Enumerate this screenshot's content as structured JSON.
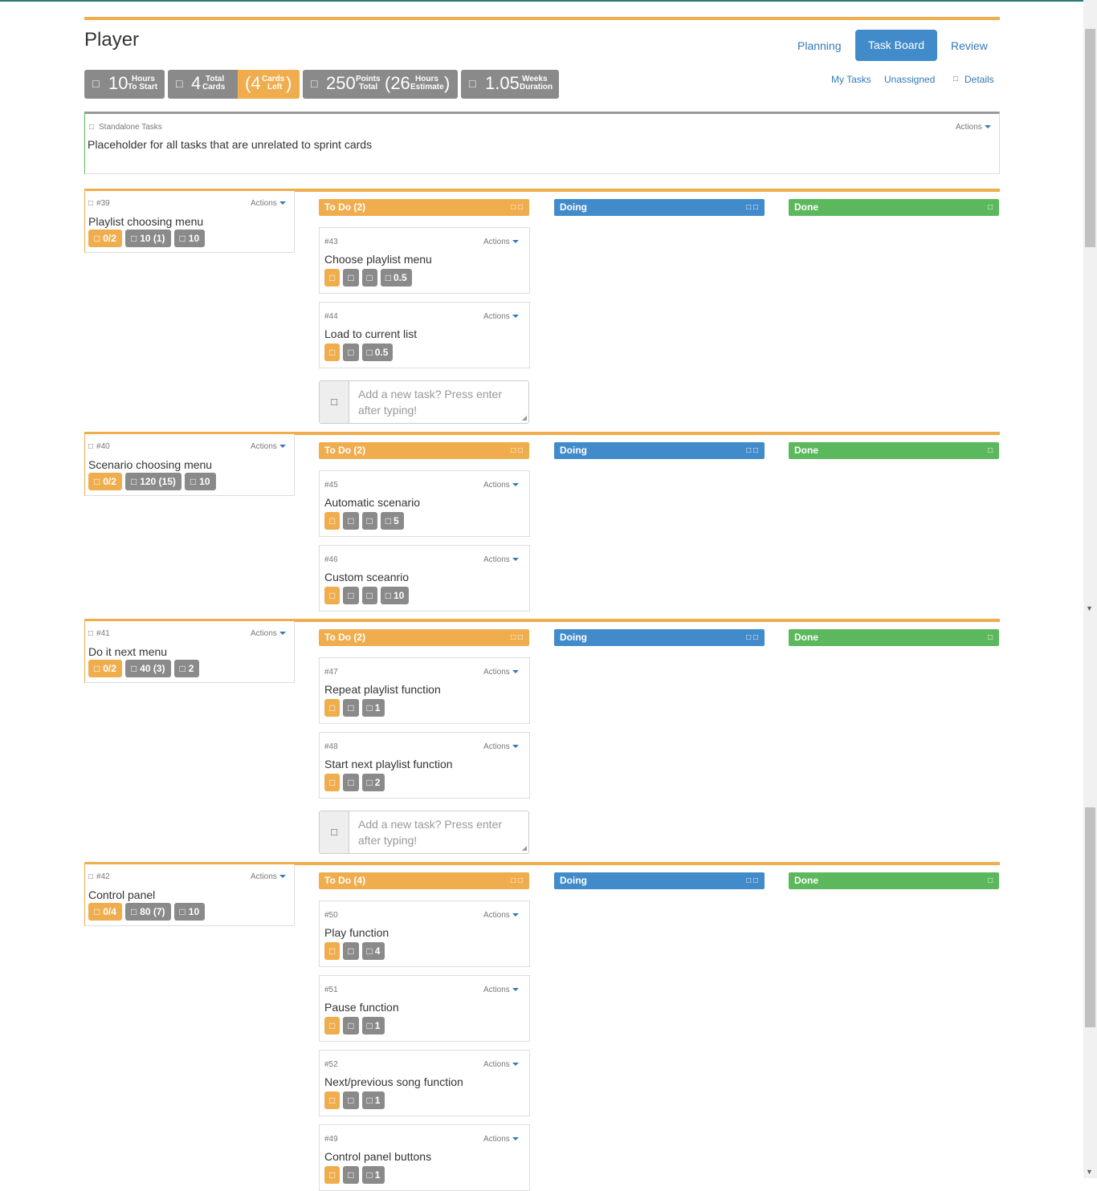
{
  "page": {
    "title": "Player"
  },
  "nav": {
    "tabs": [
      {
        "label": "Planning"
      },
      {
        "label": "Task Board"
      },
      {
        "label": "Review"
      }
    ],
    "sub_links": [
      {
        "label": "My Tasks"
      },
      {
        "label": "Unassigned"
      },
      {
        "label": "Details",
        "icon": "info-icon"
      }
    ]
  },
  "stats": {
    "hours": {
      "icon": "clock-icon",
      "value": "10",
      "l1": "Hours",
      "l2": "To Start"
    },
    "cards": {
      "icon": "card-icon",
      "value": "4",
      "l1": "Total",
      "l2": "Cards"
    },
    "cards_left": {
      "value": "(4",
      "close": ")",
      "l1": "Cards",
      "l2": "Left"
    },
    "points": {
      "icon": "trophy-icon",
      "value": "250",
      "l1": "Points",
      "l2": "Total"
    },
    "estimate": {
      "value": "(26",
      "close": ")",
      "l1": "Hours",
      "l2": "Estimate"
    },
    "weeks": {
      "icon": "calendar-icon",
      "value": "1.05",
      "l1": "Weeks",
      "l2": "Duration"
    }
  },
  "standalone": {
    "label": "Standalone Tasks",
    "description": "Placeholder for all tasks that are unrelated to sprint cards",
    "actions": "Actions"
  },
  "common": {
    "actions": "Actions",
    "doing": "Doing",
    "done": "Done",
    "add_placeholder": "Add a new task? Press enter after typing!",
    "icon": "□",
    "icon2": "□ □"
  },
  "stories": [
    {
      "num": "#39",
      "title": "Playlist choosing menu",
      "badges": [
        "0/2",
        "10 (1)",
        "10"
      ],
      "todo": "To Do (2)",
      "tasks": [
        {
          "num": "#43",
          "title": "Choose playlist menu",
          "hours": "0.5"
        },
        {
          "num": "#44",
          "title": "Load to current list",
          "hours": "0.5"
        }
      ]
    },
    {
      "num": "#40",
      "title": "Scenario choosing menu",
      "badges": [
        "0/2",
        "120 (15)",
        "10"
      ],
      "todo": "To Do (2)",
      "tasks": [
        {
          "num": "#45",
          "title": "Automatic scenario",
          "hours": "5"
        },
        {
          "num": "#46",
          "title": "Custom sceanrio",
          "hours": "10"
        }
      ]
    },
    {
      "num": "#41",
      "title": "Do it next menu",
      "badges": [
        "0/2",
        "40 (3)",
        "2"
      ],
      "todo": "To Do (2)",
      "tasks": [
        {
          "num": "#47",
          "title": "Repeat playlist function",
          "hours": "1"
        },
        {
          "num": "#48",
          "title": "Start next playlist function",
          "hours": "2"
        }
      ]
    },
    {
      "num": "#42",
      "title": "Control panel",
      "badges": [
        "0/4",
        "80 (7)",
        "10"
      ],
      "todo": "To Do (4)",
      "tasks": [
        {
          "num": "#50",
          "title": "Play function",
          "hours": "4"
        },
        {
          "num": "#51",
          "title": "Pause function",
          "hours": "1"
        },
        {
          "num": "#52",
          "title": "Next/previous song function",
          "hours": "1"
        },
        {
          "num": "#49",
          "title": "Control panel buttons",
          "hours": "1"
        }
      ]
    }
  ]
}
